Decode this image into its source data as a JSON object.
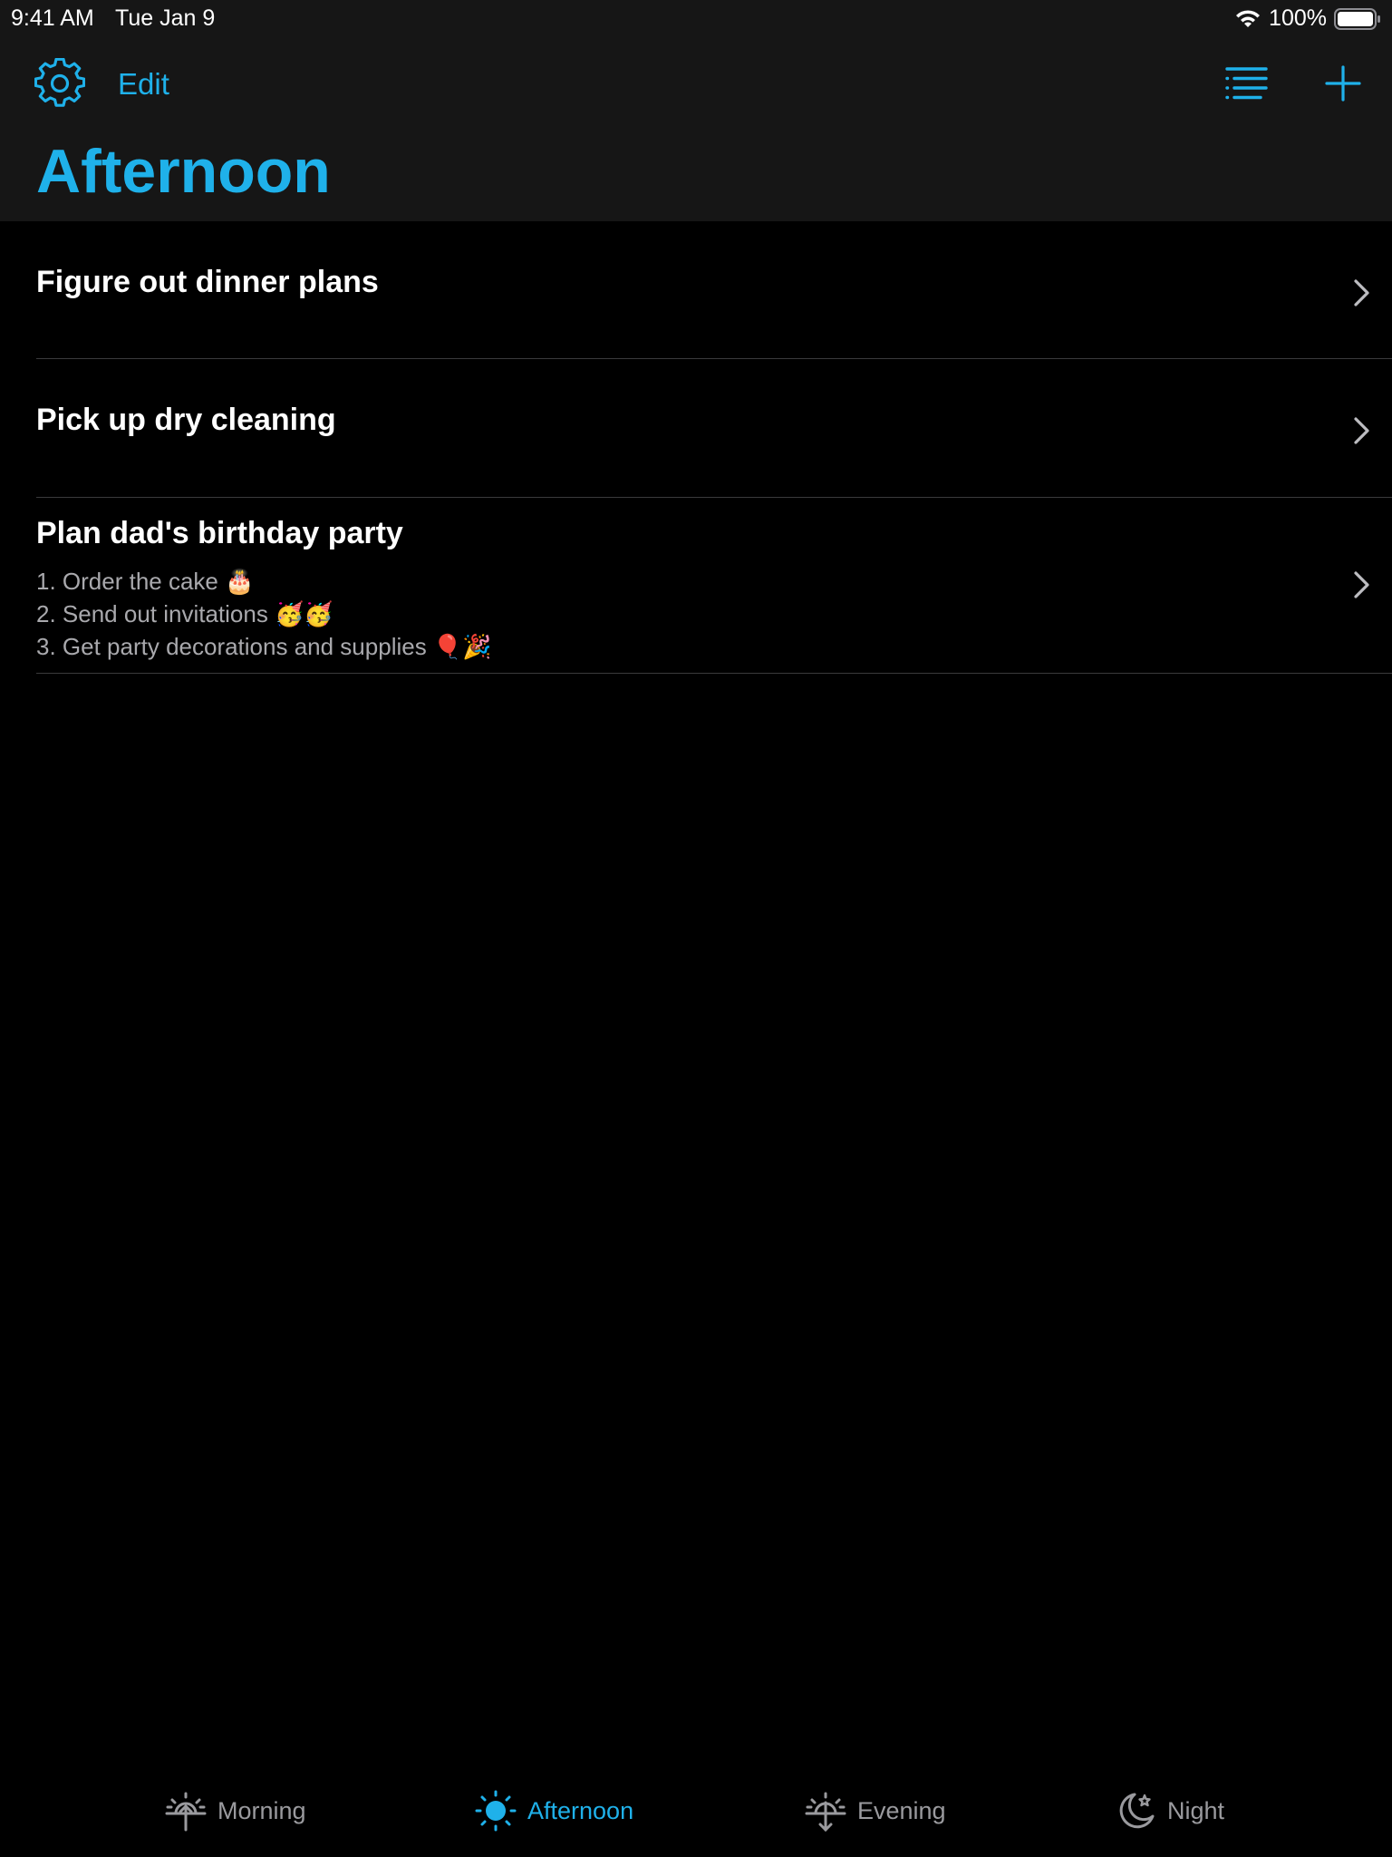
{
  "status_bar": {
    "time": "9:41 AM",
    "date": "Tue Jan 9",
    "battery_percent": "100%"
  },
  "nav": {
    "edit_label": "Edit",
    "title": "Afternoon"
  },
  "tasks": [
    {
      "title": "Figure out dinner plans",
      "notes": []
    },
    {
      "title": "Pick up dry cleaning",
      "notes": []
    },
    {
      "title": "Plan dad's birthday party",
      "notes": [
        "1. Order the cake 🎂",
        "2. Send out invitations 🥳🥳",
        "3. Get party decorations and supplies 🎈🎉"
      ]
    }
  ],
  "tabs": [
    {
      "label": "Morning",
      "icon": "sunrise-icon",
      "active": false
    },
    {
      "label": "Afternoon",
      "icon": "sun-icon",
      "active": true
    },
    {
      "label": "Evening",
      "icon": "sunset-icon",
      "active": false
    },
    {
      "label": "Night",
      "icon": "moon-stars-icon",
      "active": false
    }
  ],
  "colors": {
    "accent": "#1fb1ea",
    "background": "#000000",
    "nav_background": "#161616",
    "secondary_text": "#a9a9ad",
    "inactive_tab": "#9a9a9e"
  }
}
